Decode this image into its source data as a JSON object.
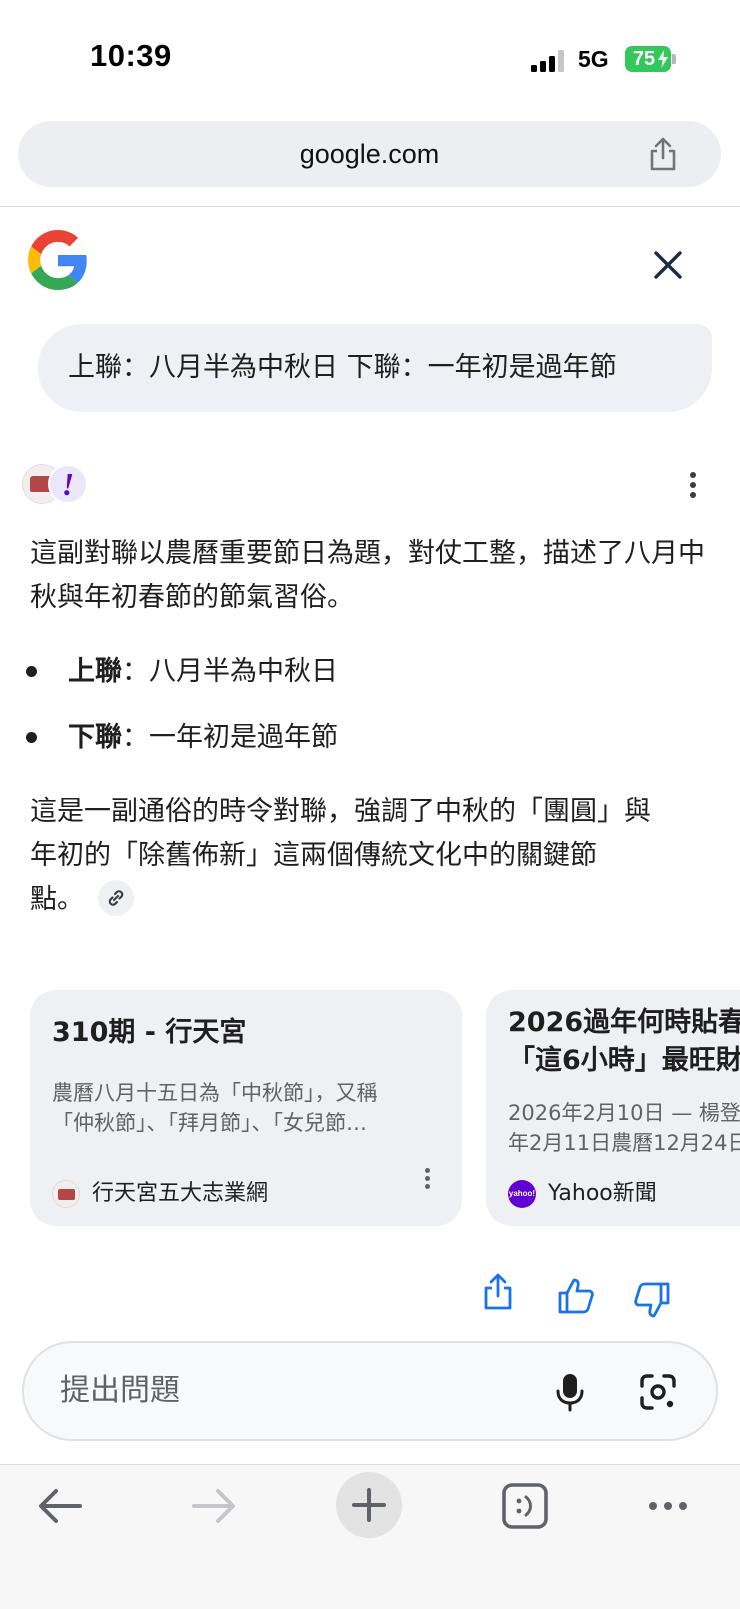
{
  "status_bar": {
    "time": "10:39",
    "network": "5G",
    "battery": "75"
  },
  "url_bar": {
    "domain": "google.com"
  },
  "query": {
    "text": "上聯：八月半為中秋日 下聯：一年初是過年節"
  },
  "answer": {
    "intro": "這副對聯以農曆重要節日為題，對仗工整，描述了八月中秋與年初春節的節氣習俗。",
    "bullets": [
      {
        "label": "上聯",
        "sep": "：",
        "text": "八月半為中秋日"
      },
      {
        "label": "下聯",
        "sep": "：",
        "text": "一年初是過年節"
      }
    ],
    "summary_line1": "這是一副通俗的時令對聯，強調了中秋的「團圓」與",
    "summary_line2": "年初的「除舊佈新」這兩個傳統文化中的關鍵節",
    "summary_line3": "點。"
  },
  "sources": [
    {
      "title": "310期 - 行天宮",
      "snippet_line1": "農曆八月十五日為「中秋節」，又稱",
      "snippet_line2": "「仲秋節」、「拜月節」、「女兒節…",
      "source_name": "行天宮五大志業網"
    },
    {
      "title_line1": "2026過年何時貼春",
      "title_line2": "「這6小時」最旺財",
      "snippet_line1": "2026年2月10日 — 楊登",
      "snippet_line2": "年2月11日農曆12月24日",
      "source_name": "Yahoo新聞",
      "source_badge": "yahoo!"
    }
  ],
  "ask_bar": {
    "placeholder": "提出問題"
  },
  "icons": {
    "share": "share-icon",
    "close": "close-icon",
    "mic": "mic-icon",
    "lens": "lens-icon",
    "thumbs_up": "thumbs-up-icon",
    "thumbs_down": "thumbs-down-icon"
  },
  "colors": {
    "accent_blue": "#1a73e8",
    "battery_green": "#34c759",
    "yahoo_purple": "#6001d2",
    "card_bg": "#eef0f4"
  }
}
